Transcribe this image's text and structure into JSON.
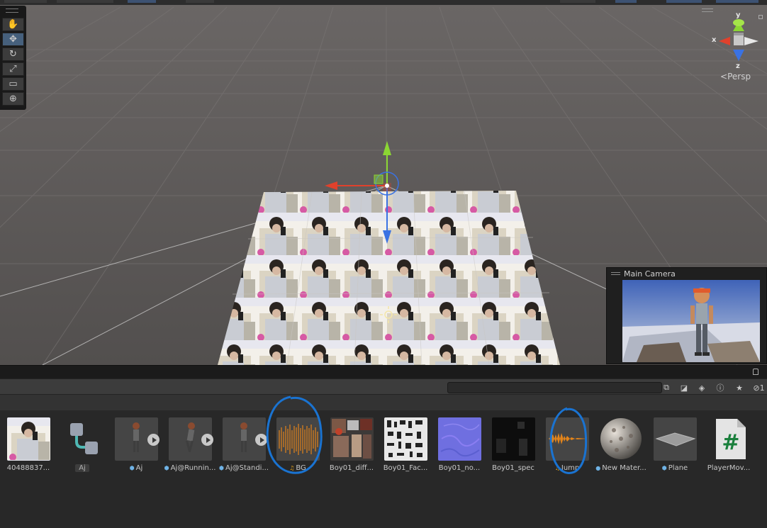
{
  "scene": {
    "persp_label": "Persp",
    "axes": {
      "x": "x",
      "y": "y",
      "z": "z"
    }
  },
  "tools": [
    {
      "name": "hand-tool",
      "glyph": "✋"
    },
    {
      "name": "move-tool",
      "glyph": "✥"
    },
    {
      "name": "rotate-tool",
      "glyph": "↻"
    },
    {
      "name": "scale-tool",
      "glyph": "⤢"
    },
    {
      "name": "rect-tool",
      "glyph": "▭"
    },
    {
      "name": "transform-tool",
      "glyph": "⊕"
    }
  ],
  "camera_preview": {
    "title": "Main Camera"
  },
  "project": {
    "search": {
      "value": "",
      "placeholder": ""
    },
    "hidden_count": "1",
    "assets": [
      {
        "label": "40488837...",
        "kind": "image"
      },
      {
        "label": "Aj",
        "kind": "animator"
      },
      {
        "label": "Aj",
        "kind": "model"
      },
      {
        "label": "Aj@Runnin...",
        "kind": "model"
      },
      {
        "label": "Aj@Standi...",
        "kind": "model"
      },
      {
        "label": "BG",
        "kind": "audio"
      },
      {
        "label": "Boy01_diff...",
        "kind": "texture-diffuse"
      },
      {
        "label": "Boy01_Fac...",
        "kind": "texture-face"
      },
      {
        "label": "Boy01_no...",
        "kind": "texture-normal"
      },
      {
        "label": "Boy01_spec",
        "kind": "texture-spec"
      },
      {
        "label": "Jump",
        "kind": "audio"
      },
      {
        "label": "New Mater...",
        "kind": "material"
      },
      {
        "label": "Plane",
        "kind": "mesh"
      },
      {
        "label": "PlayerMov...",
        "kind": "script"
      }
    ]
  },
  "colors": {
    "scene_bg": "#5b5756",
    "axis_x": "#e0412c",
    "axis_y": "#8bd633",
    "axis_z": "#3a72e3",
    "audio_wave": "#e3841a",
    "annotation": "#1a73d1"
  }
}
